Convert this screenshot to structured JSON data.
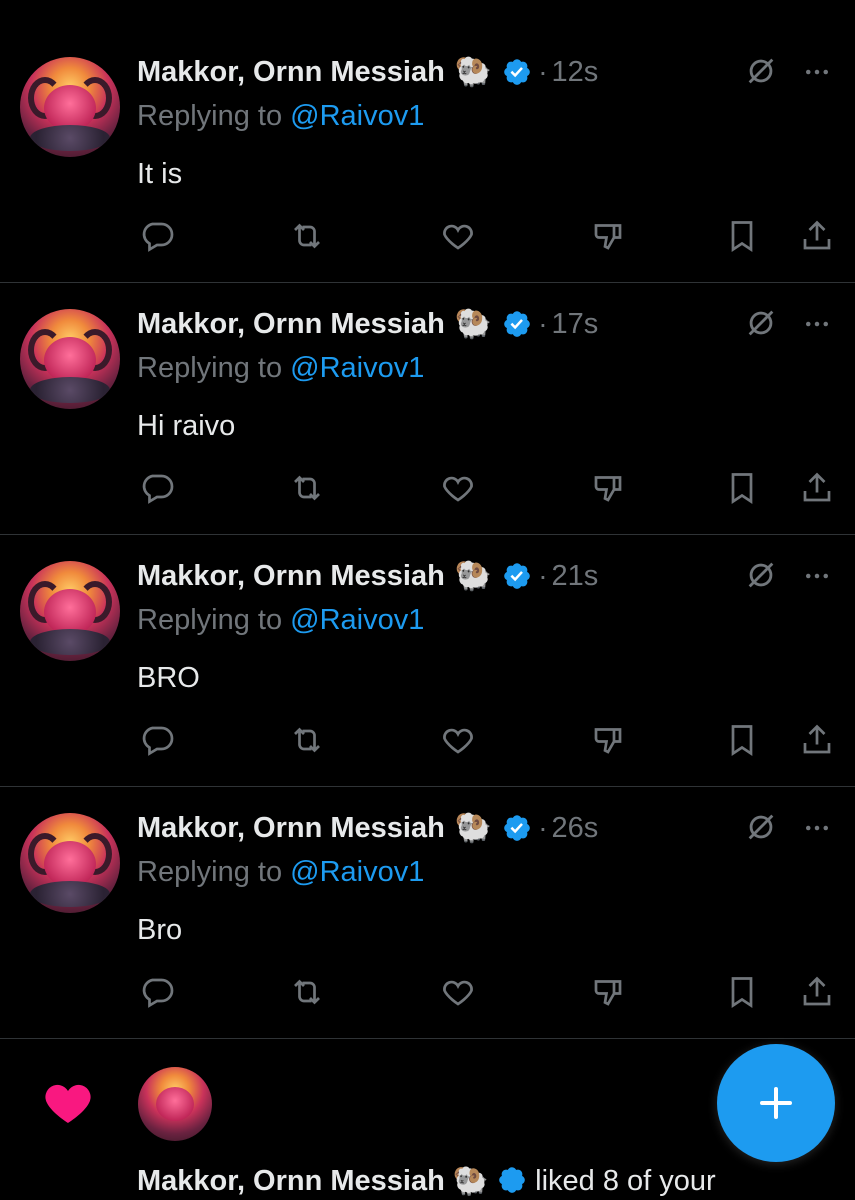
{
  "tweets": [
    {
      "author": "Makkor, Ornn Messiah",
      "emoji": "🐏",
      "time": "12s",
      "replying_prefix": "Replying to",
      "handle": "@Raivov1",
      "text": "It is"
    },
    {
      "author": "Makkor, Ornn Messiah",
      "emoji": "🐏",
      "time": "17s",
      "replying_prefix": "Replying to",
      "handle": "@Raivov1",
      "text": "Hi raivo"
    },
    {
      "author": "Makkor, Ornn Messiah",
      "emoji": "🐏",
      "time": "21s",
      "replying_prefix": "Replying to",
      "handle": "@Raivov1",
      "text": "BRO"
    },
    {
      "author": "Makkor, Ornn Messiah",
      "emoji": "🐏",
      "time": "26s",
      "replying_prefix": "Replying to",
      "handle": "@Raivov1",
      "text": "Bro"
    }
  ],
  "notification": {
    "author": "Makkor, Ornn Messiah",
    "emoji": "🐏",
    "text": "liked 8 of your"
  },
  "icons": {
    "reply": "reply-icon",
    "retweet": "retweet-icon",
    "like": "heart-icon",
    "dislike": "dislike-icon",
    "bookmark": "bookmark-icon",
    "share": "share-icon",
    "grok": "grok-icon",
    "more": "more-icon",
    "verified": "verified-badge-icon",
    "compose": "plus-icon",
    "notification_type": "heart-filled-icon"
  },
  "colors": {
    "background": "#000000",
    "text": "#e7e9ea",
    "muted": "#71767b",
    "accent": "#1d9bf0",
    "like_pink": "#f91880",
    "divider": "#2f3336"
  }
}
